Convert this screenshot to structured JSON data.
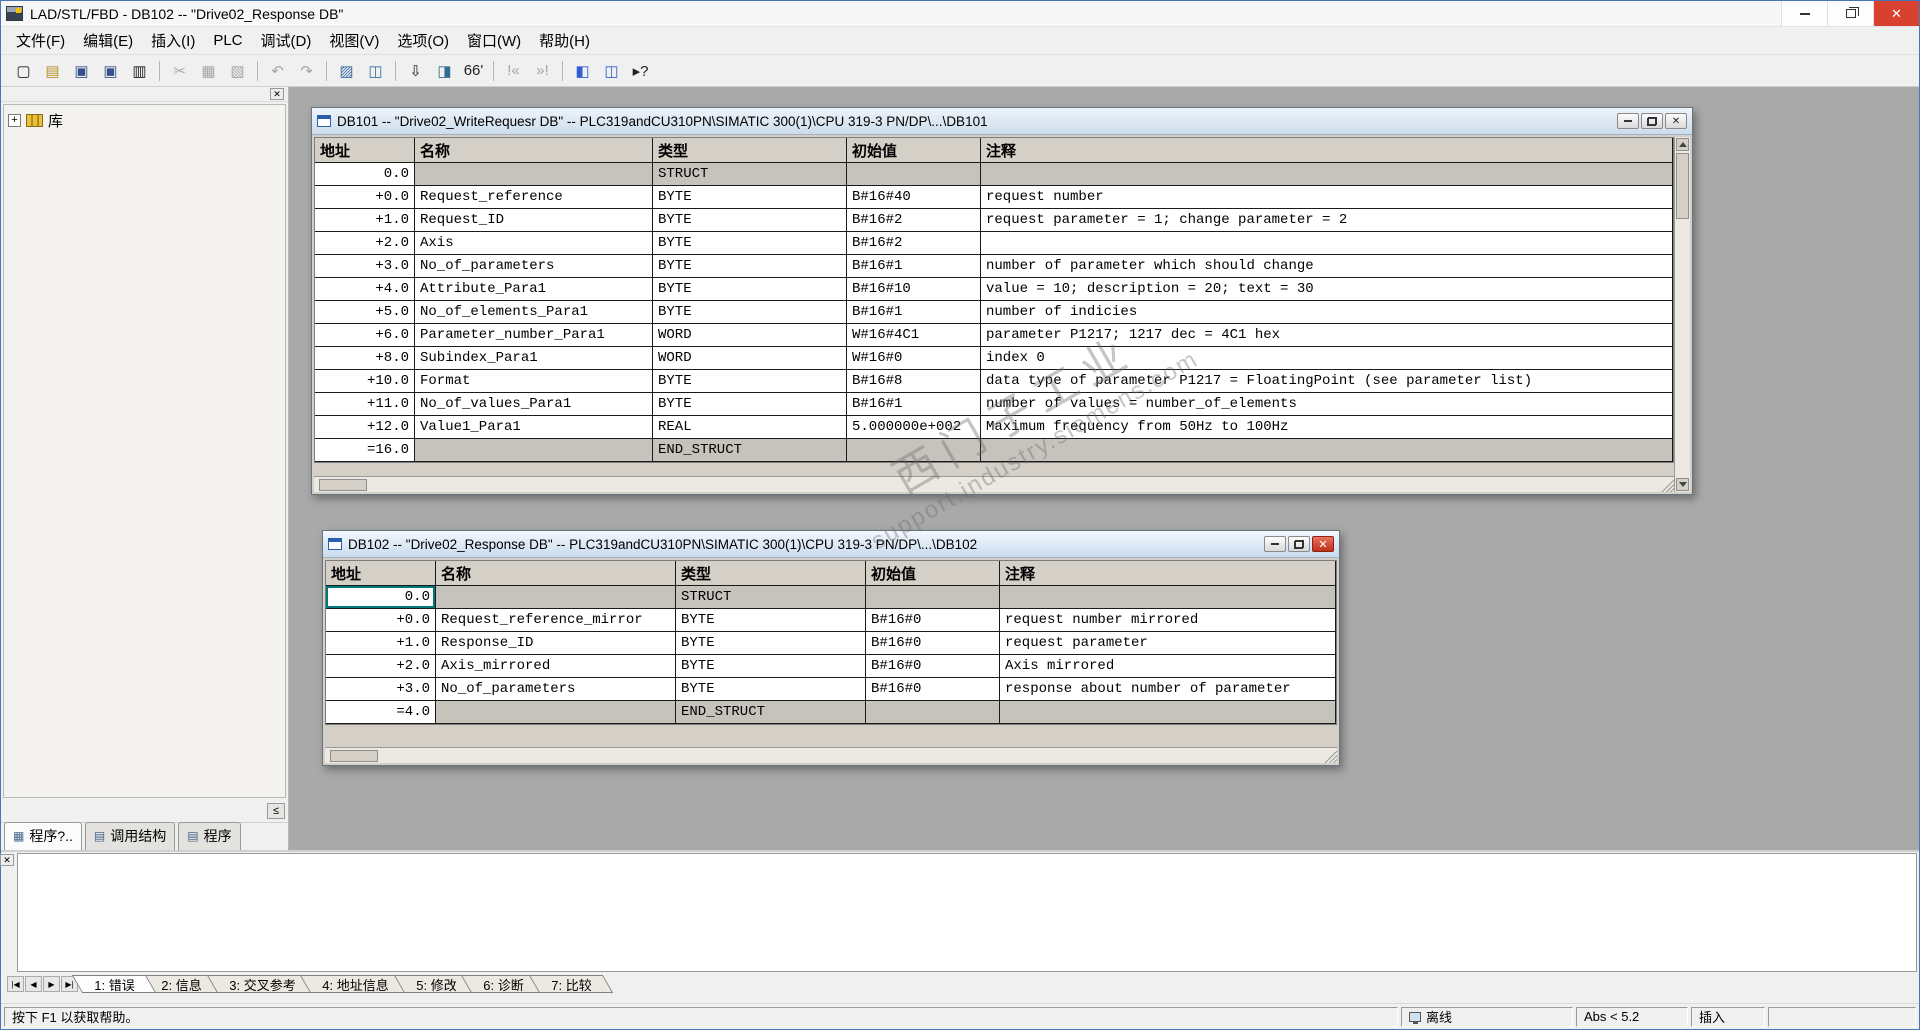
{
  "app": {
    "title": "LAD/STL/FBD  - DB102 -- \"Drive02_Response DB\"",
    "menus": [
      "文件(F)",
      "编辑(E)",
      "插入(I)",
      "PLC",
      "调试(D)",
      "视图(V)",
      "选项(O)",
      "窗口(W)",
      "帮助(H)"
    ]
  },
  "glyphs": {
    "close": "✕",
    "close_small": "✕",
    "expand": "+",
    "collapse": "≤"
  },
  "toolbar": {
    "buttons": [
      {
        "name": "new-file",
        "glyph": "▢"
      },
      {
        "name": "open-file",
        "glyph": "▤",
        "color": "#b8922c"
      },
      {
        "name": "save-as",
        "glyph": "▣",
        "color": "#33518b"
      },
      {
        "name": "save",
        "glyph": "▣",
        "color": "#33518b"
      },
      {
        "name": "print",
        "glyph": "▥"
      },
      {
        "sep": true
      },
      {
        "name": "cut",
        "glyph": "✂",
        "disabled": true
      },
      {
        "name": "copy",
        "glyph": "▦",
        "disabled": true
      },
      {
        "name": "paste",
        "glyph": "▧",
        "disabled": true
      },
      {
        "sep": true
      },
      {
        "name": "undo",
        "glyph": "↶",
        "disabled": true
      },
      {
        "name": "redo",
        "glyph": "↷",
        "disabled": true
      },
      {
        "sep": true
      },
      {
        "name": "program-elements",
        "glyph": "▨",
        "color": "#3b6ea5"
      },
      {
        "name": "reference-data",
        "glyph": "◫",
        "color": "#3b6ea5"
      },
      {
        "sep": true
      },
      {
        "name": "download",
        "glyph": "⇩"
      },
      {
        "name": "accessible-nodes",
        "glyph": "◨",
        "color": "#2f6d8e"
      },
      {
        "name": "monitor",
        "glyph": "66'"
      },
      {
        "sep": true
      },
      {
        "name": "first-error",
        "glyph": "!«",
        "disabled": true
      },
      {
        "name": "next-error",
        "glyph": "»!",
        "disabled": true
      },
      {
        "sep": true
      },
      {
        "name": "window-layout-1",
        "glyph": "◧",
        "color": "#2f5fd0"
      },
      {
        "name": "window-layout-2",
        "glyph": "◫",
        "color": "#2f5fd0"
      },
      {
        "name": "help",
        "glyph": "▸?"
      }
    ]
  },
  "sidebar": {
    "library_label": "库",
    "tab_icons": [
      "▦",
      "▤",
      "▤"
    ],
    "tabs": [
      "程序?..",
      "调用结构",
      "程序"
    ]
  },
  "columns": [
    "地址",
    "名称",
    "类型",
    "初始值",
    "注释"
  ],
  "db101": {
    "title": "DB101 -- \"Drive02_WriteRequesr DB\" -- PLC319andCU310PN\\SIMATIC 300(1)\\CPU 319-3 PN/DP\\...\\DB101",
    "rows": [
      [
        "0.0",
        "",
        "STRUCT",
        "",
        ""
      ],
      [
        "+0.0",
        "Request_reference",
        "BYTE",
        "B#16#40",
        "request number"
      ],
      [
        "+1.0",
        "Request_ID",
        "BYTE",
        "B#16#2",
        "request parameter = 1; change parameter = 2"
      ],
      [
        "+2.0",
        "Axis",
        "BYTE",
        "B#16#2",
        ""
      ],
      [
        "+3.0",
        "No_of_parameters",
        "BYTE",
        "B#16#1",
        "number of parameter which should change"
      ],
      [
        "+4.0",
        "Attribute_Para1",
        "BYTE",
        "B#16#10",
        "value = 10; description = 20; text = 30"
      ],
      [
        "+5.0",
        "No_of_elements_Para1",
        "BYTE",
        "B#16#1",
        "number of indicies"
      ],
      [
        "+6.0",
        "Parameter_number_Para1",
        "WORD",
        "W#16#4C1",
        "parameter P1217; 1217 dec = 4C1 hex"
      ],
      [
        "+8.0",
        "Subindex_Para1",
        "WORD",
        "W#16#0",
        "index 0"
      ],
      [
        "+10.0",
        "Format",
        "BYTE",
        "B#16#8",
        "data type of parameter P1217 = FloatingPoint (see parameter list)"
      ],
      [
        "+11.0",
        "No_of_values_Para1",
        "BYTE",
        "B#16#1",
        "number of values = number_of_elements"
      ],
      [
        "+12.0",
        "Value1_Para1",
        "REAL",
        "5.000000e+002",
        "Maximum frequency from 50Hz to 100Hz"
      ],
      [
        "=16.0",
        "",
        "END_STRUCT",
        "",
        ""
      ]
    ]
  },
  "db102": {
    "title": "DB102 -- \"Drive02_Response DB\" -- PLC319andCU310PN\\SIMATIC 300(1)\\CPU 319-3 PN/DP\\...\\DB102",
    "selection": {
      "row": 0,
      "col": 0
    },
    "rows": [
      [
        "0.0",
        "",
        "STRUCT",
        "",
        ""
      ],
      [
        "+0.0",
        "Request_reference_mirror",
        "BYTE",
        "B#16#0",
        "request number mirrored"
      ],
      [
        "+1.0",
        "Response_ID",
        "BYTE",
        "B#16#0",
        "request parameter"
      ],
      [
        "+2.0",
        "Axis_mirrored",
        "BYTE",
        "B#16#0",
        "Axis mirrored"
      ],
      [
        "+3.0",
        "No_of_parameters",
        "BYTE",
        "B#16#0",
        "response about number of parameter"
      ],
      [
        "=4.0",
        "",
        "END_STRUCT",
        "",
        ""
      ]
    ]
  },
  "watermark": {
    "line1": "西门子工业",
    "line2": "support.industry.siemens.com"
  },
  "output": {
    "nav": [
      "|◀",
      "◀",
      "▶",
      "▶|"
    ],
    "tabs": [
      "1: 错误",
      "2: 信息",
      "3: 交叉参考",
      "4: 地址信息",
      "5: 修改",
      "6: 诊断",
      "7: 比较"
    ]
  },
  "statusbar": {
    "help_hint": "按下 F1 以获取帮助。",
    "connection": "离线",
    "abs": "Abs < 5.2",
    "mode": "插入"
  }
}
